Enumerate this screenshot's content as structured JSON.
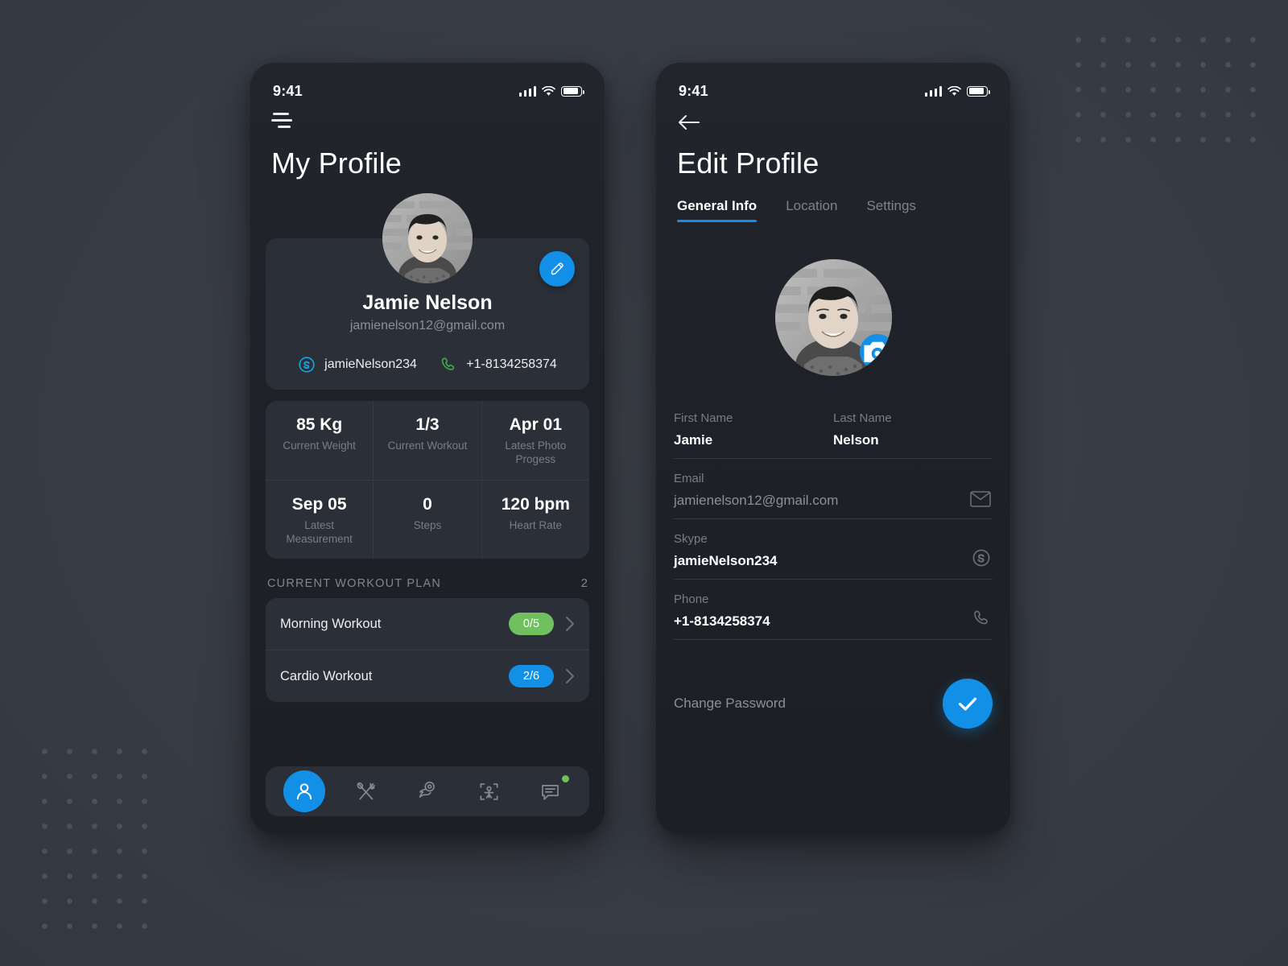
{
  "theme": {
    "accent": "#1290e8",
    "green": "#71c05f",
    "page_bg": "#3a3e48",
    "screen_bg": "#1e2127",
    "card_bg": "#2b2f37"
  },
  "left_screen": {
    "status": {
      "time": "9:41",
      "signal_icon": "signal-bars-icon",
      "wifi_icon": "wifi-icon",
      "battery_icon": "battery-icon"
    },
    "menu_icon": "hamburger-menu-icon",
    "title": "My Profile",
    "profile": {
      "avatar_icon": "user-avatar-photo",
      "edit_icon": "pencil-edit-icon",
      "name": "Jamie Nelson",
      "email": "jamienelson12@gmail.com",
      "skype_icon": "skype-icon",
      "skype": "jamieNelson234",
      "phone_icon": "phone-icon",
      "phone": "+1-8134258374"
    },
    "stats": [
      {
        "value": "85 Kg",
        "label": "Current Weight"
      },
      {
        "value": "1/3",
        "label": "Current Workout"
      },
      {
        "value": "Apr 01",
        "label": "Latest Photo Progess"
      },
      {
        "value": "Sep 05",
        "label": "Latest Measurement"
      },
      {
        "value": "0",
        "label": "Steps"
      },
      {
        "value": "120 bpm",
        "label": "Heart Rate"
      }
    ],
    "workout_section": {
      "title": "CURRENT WORKOUT PLAN",
      "count": "2",
      "items": [
        {
          "name": "Morning Workout",
          "badge": "0/5",
          "badge_color": "#71c05f",
          "chevron_icon": "chevron-right-icon"
        },
        {
          "name": "Cardio Workout",
          "badge": "2/6",
          "badge_color": "#1290e8",
          "chevron_icon": "chevron-right-icon"
        }
      ]
    },
    "tabbar": [
      {
        "icon": "person-icon",
        "active": true
      },
      {
        "icon": "cutlery-icon",
        "active": false
      },
      {
        "icon": "muscle-arm-icon",
        "active": false
      },
      {
        "icon": "body-scan-icon",
        "active": false
      },
      {
        "icon": "chat-icon",
        "active": false,
        "badge": true
      }
    ]
  },
  "right_screen": {
    "status": {
      "time": "9:41"
    },
    "back_icon": "back-arrow-icon",
    "title": "Edit Profile",
    "tabs": [
      {
        "label": "General Info",
        "selected": true
      },
      {
        "label": "Location",
        "selected": false
      },
      {
        "label": "Settings",
        "selected": false
      }
    ],
    "avatar_icon": "user-avatar-photo",
    "camera_icon": "camera-icon",
    "fields": {
      "first_name": {
        "label": "First Name",
        "value": "Jamie"
      },
      "last_name": {
        "label": "Last Name",
        "value": "Nelson"
      },
      "email": {
        "label": "Email",
        "value": "jamienelson12@gmail.com",
        "icon": "envelope-icon"
      },
      "skype": {
        "label": "Skype",
        "value": "jamieNelson234",
        "icon": "skype-icon"
      },
      "phone": {
        "label": "Phone",
        "value": "+1-8134258374",
        "icon": "phone-icon"
      }
    },
    "change_password": "Change Password",
    "save_icon": "check-icon"
  }
}
